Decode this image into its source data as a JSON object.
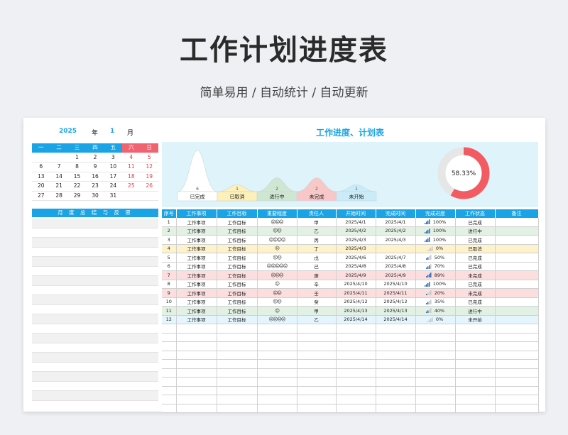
{
  "header": {
    "title": "工作计划进度表",
    "subtitle": "简单易用 / 自动统计 / 自动更新"
  },
  "calendar": {
    "year": "2025",
    "year_label": "年",
    "month": "1",
    "month_label": "月",
    "weekdays": [
      "一",
      "二",
      "三",
      "四",
      "五",
      "六",
      "日"
    ],
    "weeks": [
      [
        "",
        "",
        "1",
        "2",
        "3",
        "4",
        "5"
      ],
      [
        "6",
        "7",
        "8",
        "9",
        "10",
        "11",
        "12"
      ],
      [
        "13",
        "14",
        "15",
        "16",
        "17",
        "18",
        "19"
      ],
      [
        "20",
        "21",
        "22",
        "23",
        "24",
        "25",
        "26"
      ],
      [
        "27",
        "28",
        "29",
        "30",
        "31",
        "",
        ""
      ]
    ]
  },
  "summary": {
    "title": "月 度 总 结 与 反 思"
  },
  "chart": {
    "title": "工作进度、计划表",
    "percent_label": "58.33%",
    "percent": 58.33,
    "accent": "#f25b62",
    "chart_data": {
      "type": "area",
      "categories": [
        "已完成",
        "已取消",
        "进行中",
        "未完成",
        "未开始"
      ],
      "values": [
        6,
        1,
        2,
        2,
        1
      ],
      "colors": [
        "#ffffff",
        "#fdf0b8",
        "#cfe6d2",
        "#f8c7c7",
        "#c9ecf8"
      ]
    }
  },
  "table": {
    "columns": [
      "序号",
      "工作事项",
      "工作目标",
      "重要程度",
      "责任人",
      "开始时间",
      "完成时间",
      "完成进度",
      "工作状态",
      "备注"
    ],
    "rows": [
      {
        "no": "1",
        "item": "工作事项",
        "goal": "工作目标",
        "faces": "☹☹☹",
        "owner": "甲",
        "start": "2025/4/1",
        "end": "2025/4/1",
        "progress": "100%",
        "bars": 4,
        "status": "已完成",
        "color": "white"
      },
      {
        "no": "2",
        "item": "工作事项",
        "goal": "工作目标",
        "faces": "☹☹",
        "owner": "乙",
        "start": "2025/4/2",
        "end": "2025/4/2",
        "progress": "100%",
        "bars": 4,
        "status": "进行中",
        "color": "green"
      },
      {
        "no": "3",
        "item": "工作事项",
        "goal": "工作目标",
        "faces": "☹☹☹☹",
        "owner": "丙",
        "start": "2025/4/3",
        "end": "2025/4/3",
        "progress": "100%",
        "bars": 4,
        "status": "已完成",
        "color": "white"
      },
      {
        "no": "4",
        "item": "工作事项",
        "goal": "工作目标",
        "faces": "☹",
        "owner": "丁",
        "start": "2025/4/3",
        "end": "",
        "progress": "0%",
        "bars": 0,
        "status": "已取消",
        "color": "yellow"
      },
      {
        "no": "5",
        "item": "工作事项",
        "goal": "工作目标",
        "faces": "☹☹",
        "owner": "戊",
        "start": "2025/4/6",
        "end": "2025/4/7",
        "progress": "50%",
        "bars": 2,
        "status": "已完成",
        "color": "white"
      },
      {
        "no": "6",
        "item": "工作事项",
        "goal": "工作目标",
        "faces": "☹☹☹☹☹",
        "owner": "己",
        "start": "2025/4/8",
        "end": "2025/4/8",
        "progress": "70%",
        "bars": 3,
        "status": "已完成",
        "color": "white"
      },
      {
        "no": "7",
        "item": "工作事项",
        "goal": "工作目标",
        "faces": "☹☹☹",
        "owner": "庚",
        "start": "2025/4/9",
        "end": "2025/4/9",
        "progress": "89%",
        "bars": 4,
        "status": "未完成",
        "color": "red"
      },
      {
        "no": "8",
        "item": "工作事项",
        "goal": "工作目标",
        "faces": "☹",
        "owner": "辛",
        "start": "2025/4/10",
        "end": "2025/4/10",
        "progress": "100%",
        "bars": 4,
        "status": "已完成",
        "color": "white"
      },
      {
        "no": "9",
        "item": "工作事项",
        "goal": "工作目标",
        "faces": "☹☹",
        "owner": "壬",
        "start": "2025/4/11",
        "end": "2025/4/11",
        "progress": "20%",
        "bars": 1,
        "status": "未完成",
        "color": "red"
      },
      {
        "no": "10",
        "item": "工作事项",
        "goal": "工作目标",
        "faces": "☹☹",
        "owner": "癸",
        "start": "2025/4/12",
        "end": "2025/4/12",
        "progress": "35%",
        "bars": 2,
        "status": "已完成",
        "color": "white"
      },
      {
        "no": "11",
        "item": "工作事项",
        "goal": "工作目标",
        "faces": "☹",
        "owner": "甲",
        "start": "2025/4/13",
        "end": "2025/4/13",
        "progress": "40%",
        "bars": 2,
        "status": "进行中",
        "color": "green"
      },
      {
        "no": "12",
        "item": "工作事项",
        "goal": "工作目标",
        "faces": "☹☹☹☹",
        "owner": "乙",
        "start": "2025/4/14",
        "end": "2025/4/14",
        "progress": "0%",
        "bars": 0,
        "status": "未开始",
        "color": "blue"
      }
    ],
    "empty_rows": 10
  }
}
